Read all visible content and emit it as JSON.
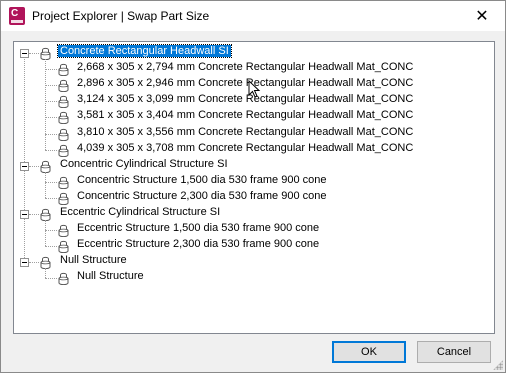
{
  "window": {
    "title": "Project Explorer | Swap Part Size",
    "close_glyph": "✕",
    "app_icon_letter": "C"
  },
  "tree": {
    "groups": [
      {
        "label": "Concrete Rectangular Headwall SI",
        "selected": true,
        "items": [
          "2,668 x 305 x 2,794 mm Concrete Rectangular Headwall Mat_CONC",
          "2,896 x 305 x 2,946 mm Concrete Rectangular Headwall Mat_CONC",
          "3,124 x 305 x 3,099 mm Concrete Rectangular Headwall Mat_CONC",
          "3,581 x 305 x 3,404 mm Concrete Rectangular Headwall Mat_CONC",
          "3,810 x 305 x 3,556 mm Concrete Rectangular Headwall Mat_CONC",
          "4,039 x 305 x 3,708 mm Concrete Rectangular Headwall Mat_CONC"
        ]
      },
      {
        "label": "Concentric Cylindrical Structure SI",
        "selected": false,
        "items": [
          "Concentric Structure 1,500 dia 530 frame 900 cone",
          "Concentric Structure 2,300 dia 530 frame 900 cone"
        ]
      },
      {
        "label": "Eccentric Cylindrical Structure SI",
        "selected": false,
        "items": [
          "Eccentric Structure 1,500 dia 530 frame 900 cone",
          "Eccentric Structure 2,300 dia 530 frame 900 cone"
        ]
      },
      {
        "label": "Null Structure",
        "selected": false,
        "items": [
          "Null Structure"
        ]
      }
    ]
  },
  "buttons": {
    "ok_label": "OK",
    "cancel_label": "Cancel"
  },
  "colors": {
    "selection": "#0078d7",
    "icon_stroke": "#555555"
  }
}
